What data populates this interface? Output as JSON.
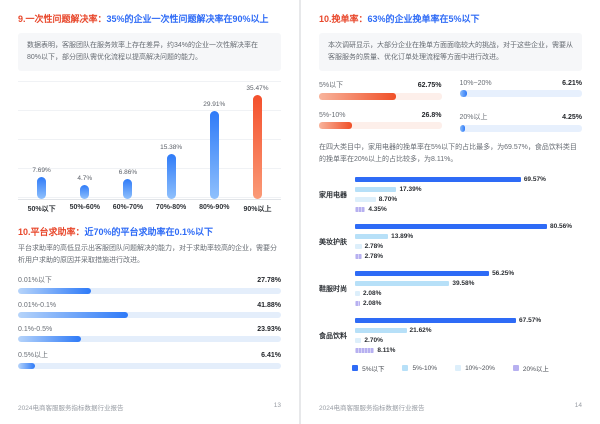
{
  "left_page": {
    "sec9": {
      "title_prefix": "9.一次性问题解决率：",
      "title_rest": "35%的企业一次性问题解决率在90%以上",
      "description": "数据表明，客服团队在服务效率上存在差异，约34%的企业一次性解决率在80%以下，部分团队需优化流程以提高解决问题的能力。"
    },
    "sec10": {
      "title_prefix": "10.平台求助率：",
      "title_rest": "近70%的平台求助率在0.1%以下",
      "description": "平台求助率的高低显示出客服团队问题解决的能力，对于求助率较高的企业，需要分析用户求助的原因并采取措施进行改进。"
    },
    "footer": {
      "text": "2024电商客服服务指标数据行业报告",
      "page": "13"
    }
  },
  "right_page": {
    "sec10": {
      "title_prefix": "10.挽单率：",
      "title_rest": "63%的企业挽单率在5%以下",
      "description": "本次调研显示，大部分企业在挽单方面面临较大的挑战，对于这些企业，需要从客服服务的质量、优化订单处理流程等方面中进行改进。",
      "paragraph": "在四大类目中，家用电器的挽单率在5%以下的占比最多，为69.57%，食品饮料类目的挽单率在20%以上的占比较多，为8.11%。"
    },
    "footer": {
      "text": "2024电商客服服务指标数据行业报告",
      "page": "14"
    }
  },
  "colors": {
    "accent_red": "#E8472B",
    "accent_blue": "#2E6BF6",
    "bar_blue_top": "#2F7BF8",
    "bar_blue_bottom": "#8FC0FC",
    "bar_red_top": "#F4502C",
    "bar_red_bottom": "#FA9A77",
    "track_blue": "#E4EEFB",
    "track_red": "#FDEFEA"
  },
  "chart_data": [
    {
      "type": "bar",
      "title": "一次性问题解决率分布",
      "categories": [
        "50%以下",
        "50%-60%",
        "60%-70%",
        "70%-80%",
        "80%-90%",
        "90%以上"
      ],
      "values": [
        7.69,
        4.7,
        6.86,
        15.38,
        29.91,
        35.47
      ],
      "value_labels": [
        "7.69%",
        "4.7%",
        "6.86%",
        "15.38%",
        "29.91%",
        "35.47%"
      ],
      "highlight_index": 5,
      "unit": "%",
      "ylim": [
        0,
        40
      ],
      "grid": true,
      "xlabel": "",
      "ylabel": ""
    },
    {
      "type": "bar",
      "orientation": "horizontal",
      "title": "平台求助率分布",
      "categories": [
        "0.01%以下",
        "0.01%-0.1%",
        "0.1%-0.5%",
        "0.5%以上"
      ],
      "values": [
        27.78,
        41.88,
        23.93,
        6.41
      ],
      "value_labels": [
        "27.78%",
        "41.88%",
        "23.93%",
        "6.41%"
      ],
      "unit": "%"
    },
    {
      "type": "bar",
      "orientation": "horizontal",
      "title": "挽单率分布",
      "categories": [
        "5%以下",
        "5%-10%",
        "10%~20%",
        "20%以上"
      ],
      "values": [
        62.75,
        26.8,
        6.21,
        4.25
      ],
      "value_labels": [
        "62.75%",
        "26.8%",
        "6.21%",
        "4.25%"
      ],
      "themes": [
        "red",
        "red",
        "blue",
        "blue"
      ],
      "display_order": [
        0,
        2,
        1,
        3
      ],
      "unit": "%"
    },
    {
      "type": "bar",
      "orientation": "horizontal",
      "grouped": true,
      "title": "四大类目挽单率分布",
      "categories": [
        "家用电器",
        "美妆护肤",
        "鞋服时尚",
        "食品饮料"
      ],
      "series": [
        {
          "name": "5%以下",
          "color": "#2E6BF6",
          "values": [
            69.57,
            80.56,
            56.25,
            67.57
          ],
          "value_labels": [
            "69.57%",
            "80.56%",
            "56.25%",
            "67.57%"
          ]
        },
        {
          "name": "5%-10%",
          "color": "#B7E0F8",
          "values": [
            17.39,
            13.89,
            39.58,
            21.62
          ],
          "value_labels": [
            "17.39%",
            "13.89%",
            "39.58%",
            "21.62%"
          ]
        },
        {
          "name": "10%~20%",
          "color": "#DDEFFB",
          "values": [
            8.7,
            2.78,
            2.08,
            2.7
          ],
          "value_labels": [
            "8.70%",
            "2.78%",
            "2.08%",
            "2.70%"
          ]
        },
        {
          "name": "20%以上",
          "color": "#B7B0F0",
          "values": [
            4.35,
            2.78,
            2.08,
            8.11
          ],
          "value_labels": [
            "4.35%",
            "2.78%",
            "2.08%",
            "8.11%"
          ]
        }
      ],
      "legend_position": "bottom",
      "unit": "%"
    }
  ]
}
